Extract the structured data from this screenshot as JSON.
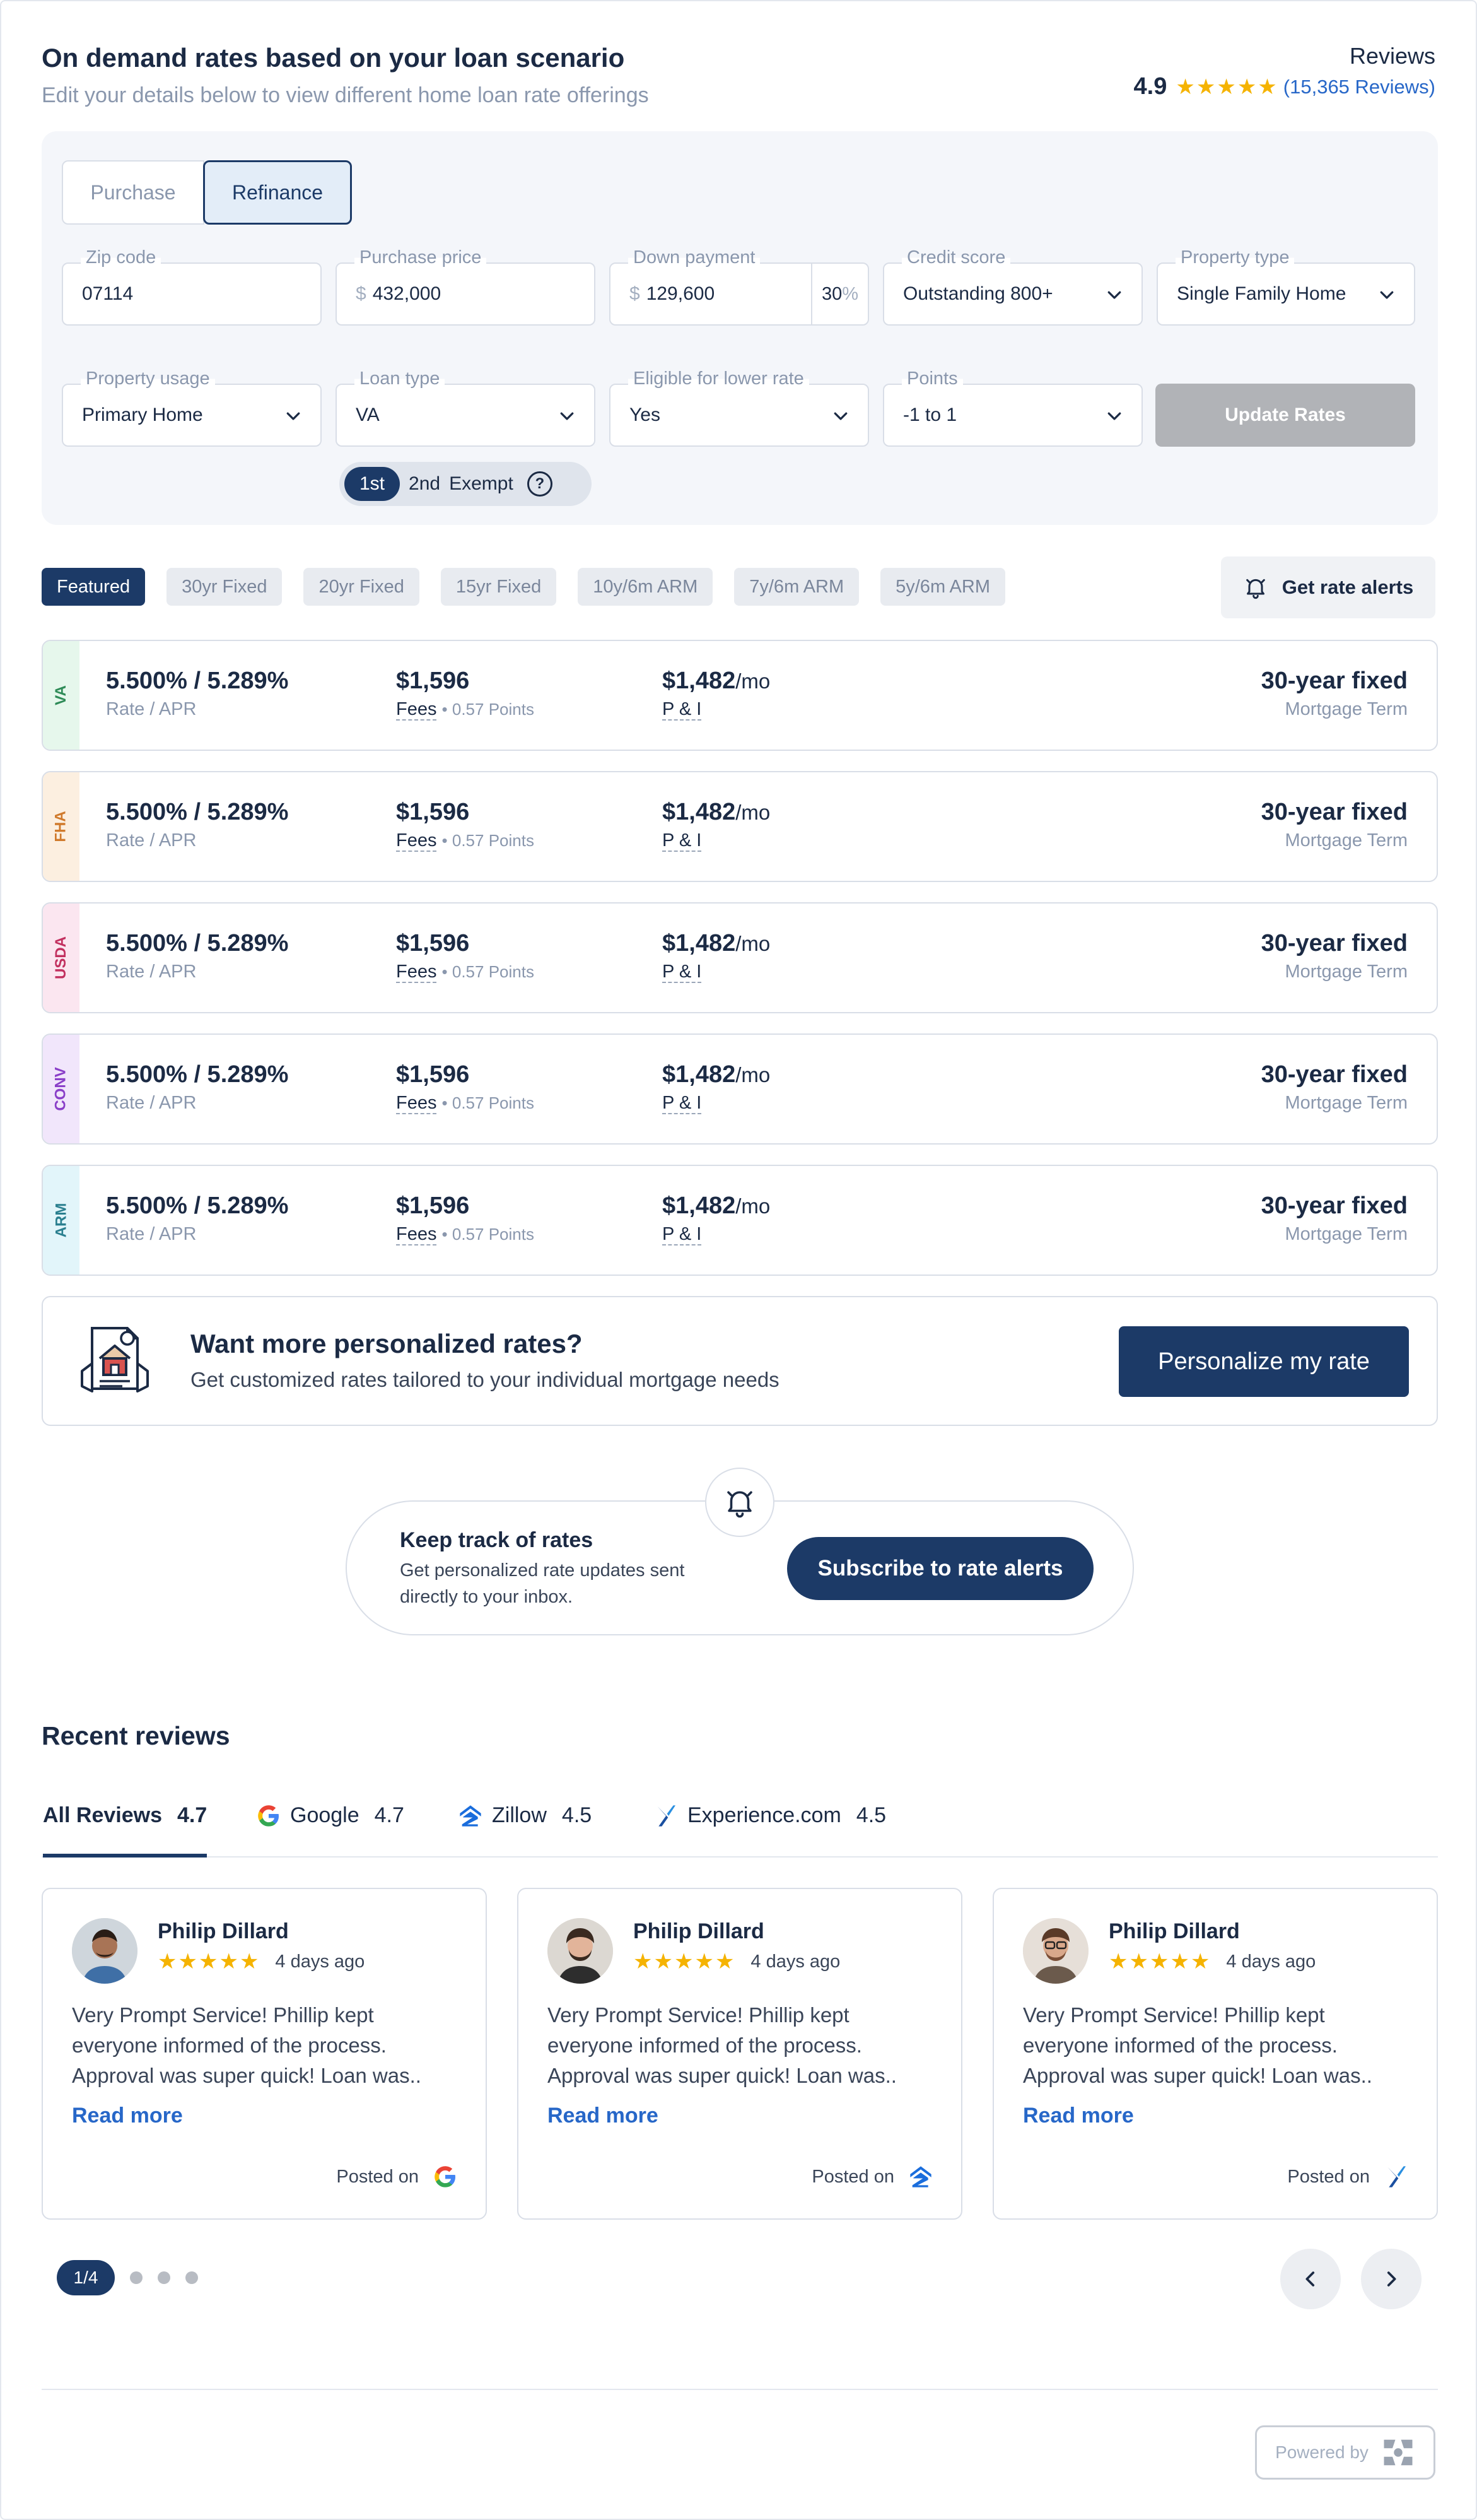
{
  "header": {
    "title": "On demand rates based on your loan scenario",
    "subtitle": "Edit your details below to view different home loan rate offerings",
    "reviews_label": "Reviews",
    "rating": "4.9",
    "review_count": "(15,365 Reviews)",
    "star_color": "#f5b301"
  },
  "form": {
    "segment": {
      "purchase": "Purchase",
      "refinance": "Refinance",
      "selected": "Refinance"
    },
    "zip": {
      "label": "Zip code",
      "value": "07114"
    },
    "price": {
      "label": "Purchase price",
      "prefix": "$",
      "value": "432,000"
    },
    "down": {
      "label": "Down payment",
      "prefix": "$",
      "value": "129,600",
      "percent": "30",
      "percent_sign": "%"
    },
    "credit": {
      "label": "Credit score",
      "value": "Outstanding 800+"
    },
    "property_type": {
      "label": "Property type",
      "value": "Single Family Home"
    },
    "usage": {
      "label": "Property usage",
      "value": "Primary Home"
    },
    "loan_type": {
      "label": "Loan type",
      "value": "VA"
    },
    "lower_rate": {
      "label": "Eligible for lower rate",
      "value": "Yes"
    },
    "points": {
      "label": "Points",
      "value": "-1 to 1"
    },
    "update_button": "Update Rates",
    "lien": {
      "first": "1st",
      "second": "2nd",
      "exempt": "Exempt",
      "help": "?"
    }
  },
  "term_tabs": [
    "Featured",
    "30yr Fixed",
    "20yr Fixed",
    "15yr Fixed",
    "10y/6m ARM",
    "7y/6m ARM",
    "5y/6m ARM"
  ],
  "alerts_button": "Get rate alerts",
  "rates": [
    {
      "tag": "VA",
      "tag_bg": "#e6f7ec",
      "tag_color": "#2e8b57",
      "rate": "5.500% / 5.289%",
      "rate_label": "Rate / APR",
      "fees": "$1,596",
      "fees_label": "Fees",
      "points": "0.57 Points",
      "payment": "$1,482",
      "payment_unit": "/mo",
      "payment_label": "P & I",
      "term": "30-year fixed",
      "term_label": "Mortgage Term"
    },
    {
      "tag": "FHA",
      "tag_bg": "#fcefe0",
      "tag_color": "#d07a2c",
      "rate": "5.500% / 5.289%",
      "rate_label": "Rate / APR",
      "fees": "$1,596",
      "fees_label": "Fees",
      "points": "0.57 Points",
      "payment": "$1,482",
      "payment_unit": "/mo",
      "payment_label": "P & I",
      "term": "30-year fixed",
      "term_label": "Mortgage Term"
    },
    {
      "tag": "USDA",
      "tag_bg": "#fbe6f0",
      "tag_color": "#c2305f",
      "rate": "5.500% / 5.289%",
      "rate_label": "Rate / APR",
      "fees": "$1,596",
      "fees_label": "Fees",
      "points": "0.57 Points",
      "payment": "$1,482",
      "payment_unit": "/mo",
      "payment_label": "P & I",
      "term": "30-year fixed",
      "term_label": "Mortgage Term"
    },
    {
      "tag": "CONV",
      "tag_bg": "#f1e6fb",
      "tag_color": "#8a3fc8",
      "rate": "5.500% / 5.289%",
      "rate_label": "Rate / APR",
      "fees": "$1,596",
      "fees_label": "Fees",
      "points": "0.57 Points",
      "payment": "$1,482",
      "payment_unit": "/mo",
      "payment_label": "P & I",
      "term": "30-year fixed",
      "term_label": "Mortgage Term"
    },
    {
      "tag": "ARM",
      "tag_bg": "#e2f5fa",
      "tag_color": "#2a7f8f",
      "rate": "5.500% / 5.289%",
      "rate_label": "Rate / APR",
      "fees": "$1,596",
      "fees_label": "Fees",
      "points": "0.57 Points",
      "payment": "$1,482",
      "payment_unit": "/mo",
      "payment_label": "P & I",
      "term": "30-year fixed",
      "term_label": "Mortgage Term"
    }
  ],
  "promo": {
    "title": "Want more personalized rates?",
    "subtitle": "Get customized rates tailored to your individual mortgage needs",
    "button": "Personalize my rate"
  },
  "subscribe": {
    "title": "Keep track of rates",
    "text": "Get personalized rate updates sent directly to your inbox.",
    "button": "Subscribe to rate alerts"
  },
  "reviews_section": {
    "title": "Recent reviews",
    "tabs": [
      {
        "label": "All Reviews",
        "score": "4.7"
      },
      {
        "label": "Google",
        "score": "4.7"
      },
      {
        "label": "Zillow",
        "score": "4.5"
      },
      {
        "label": "Experience.com",
        "score": "4.5"
      }
    ],
    "cards": [
      {
        "name": "Philip Dillard",
        "date": "4 days ago",
        "text": "Very Prompt Service! Phillip kept everyone informed of the process. Approval was super quick! Loan was..",
        "read_more": "Read more",
        "posted_on": "Posted on",
        "source_icon": "google-icon"
      },
      {
        "name": "Philip Dillard",
        "date": "4 days ago",
        "text": "Very Prompt Service! Phillip kept everyone informed of the process. Approval was super quick! Loan was..",
        "read_more": "Read more",
        "posted_on": "Posted on",
        "source_icon": "zillow-icon"
      },
      {
        "name": "Philip Dillard",
        "date": "4 days ago",
        "text": "Very Prompt Service! Phillip kept everyone informed of the process. Approval was super quick! Loan was..",
        "read_more": "Read more",
        "posted_on": "Posted on",
        "source_icon": "experience-icon"
      }
    ],
    "pager": "1/4"
  },
  "footer": {
    "powered_by": "Powered by"
  }
}
